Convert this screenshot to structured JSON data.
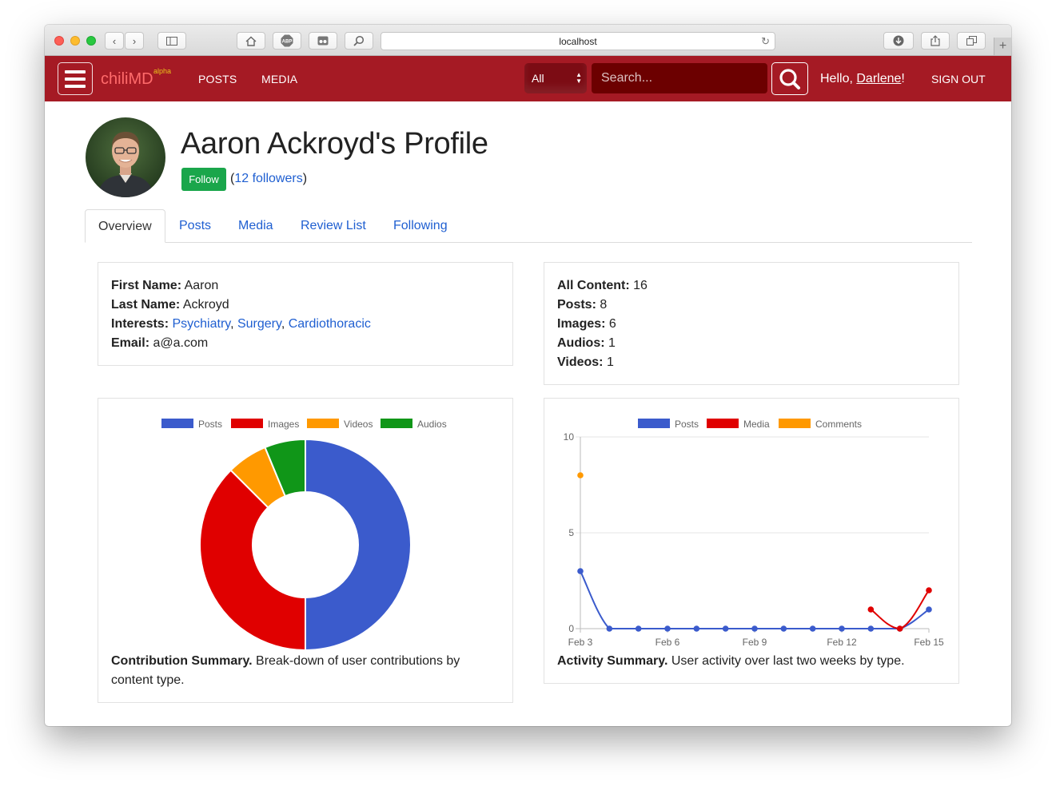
{
  "browser": {
    "url": "localhost"
  },
  "navbar": {
    "brand": "chiliMD",
    "brand_badge": "alpha",
    "links": [
      "POSTS",
      "MEDIA"
    ],
    "search_scope": "All",
    "search_placeholder": "Search...",
    "greeting": "Hello,",
    "user_name": "Darlene",
    "greeting_suffix": "!",
    "sign_out": "SIGN OUT",
    "brand_color": "#a51a24"
  },
  "profile": {
    "title": "Aaron Ackroyd's Profile",
    "follow_label": "Follow",
    "followers_open": "(",
    "followers_link": "12 followers",
    "followers_close": ")"
  },
  "tabs": [
    "Overview",
    "Posts",
    "Media",
    "Review List",
    "Following"
  ],
  "active_tab": "Overview",
  "details": {
    "first_name_label": "First Name:",
    "first_name": "Aaron",
    "last_name_label": "Last Name:",
    "last_name": "Ackroyd",
    "interests_label": "Interests:",
    "interests": [
      "Psychiatry",
      "Surgery",
      "Cardiothoracic"
    ],
    "email_label": "Email:",
    "email": "a@a.com"
  },
  "stats": [
    {
      "label": "All Content:",
      "value": "16"
    },
    {
      "label": "Posts:",
      "value": "8"
    },
    {
      "label": "Images:",
      "value": "6"
    },
    {
      "label": "Audios:",
      "value": "1"
    },
    {
      "label": "Videos:",
      "value": "1"
    }
  ],
  "contribution": {
    "caption_bold": "Contribution Summary.",
    "caption_text": "Break-down of user contributions by content type."
  },
  "activity": {
    "caption_bold": "Activity Summary.",
    "caption_text": "User activity over last two weeks by type."
  },
  "chart_data": [
    {
      "type": "pie",
      "variant": "doughnut",
      "categories": [
        "Posts",
        "Images",
        "Videos",
        "Audios"
      ],
      "values": [
        8,
        6,
        1,
        1
      ],
      "colors": [
        "#3b5bcc",
        "#e00000",
        "#ff9900",
        "#109618"
      ],
      "legend": "top"
    },
    {
      "type": "line",
      "x": [
        "Feb 3",
        "Feb 4",
        "Feb 5",
        "Feb 6",
        "Feb 7",
        "Feb 8",
        "Feb 9",
        "Feb 10",
        "Feb 11",
        "Feb 12",
        "Feb 13",
        "Feb 14",
        "Feb 15"
      ],
      "xticks": [
        "Feb 3",
        "Feb 6",
        "Feb 9",
        "Feb 12",
        "Feb 15"
      ],
      "series": [
        {
          "name": "Posts",
          "color": "#3b5bcc",
          "values": [
            3,
            0,
            0,
            0,
            0,
            0,
            0,
            0,
            0,
            0,
            0,
            0,
            1
          ]
        },
        {
          "name": "Media",
          "color": "#e00000",
          "values": [
            null,
            null,
            null,
            null,
            null,
            null,
            null,
            null,
            null,
            null,
            1,
            0,
            2
          ]
        },
        {
          "name": "Comments",
          "color": "#ff9900",
          "values": [
            8,
            null,
            null,
            null,
            null,
            null,
            null,
            null,
            null,
            null,
            null,
            null,
            null
          ]
        }
      ],
      "yticks": [
        0,
        5,
        10
      ],
      "ylim": [
        0,
        10
      ],
      "grid": true,
      "legend": "top"
    }
  ]
}
